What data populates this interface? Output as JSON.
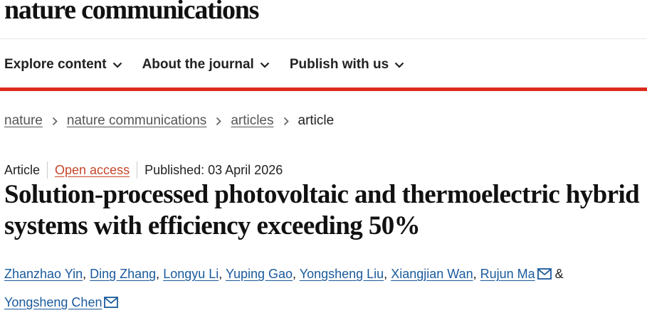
{
  "brand": {
    "name": "nature communications"
  },
  "nav": {
    "items": [
      {
        "label": "Explore content",
        "icon": "chevron-down-icon"
      },
      {
        "label": "About the journal",
        "icon": "chevron-down-icon"
      },
      {
        "label": "Publish with us",
        "icon": "chevron-down-icon"
      }
    ]
  },
  "colors": {
    "accent_rule": "#dd2b1e",
    "open_access": "#c6462a",
    "author_link": "#1a5a9c"
  },
  "breadcrumb": {
    "items": [
      {
        "label": "nature",
        "link": true
      },
      {
        "label": "nature communications",
        "link": true
      },
      {
        "label": "articles",
        "link": true
      },
      {
        "label": "article",
        "link": false
      }
    ],
    "separator_icon": "chevron-right-icon"
  },
  "meta": {
    "type": "Article",
    "access": "Open access",
    "published": "Published: 03 April 2026"
  },
  "article": {
    "title": "Solution-processed photovoltaic and thermoelectric hybrid systems with efficiency exceeding 50%"
  },
  "authors": {
    "list": [
      {
        "name": "Zhanzhao Yin",
        "sep": ", "
      },
      {
        "name": "Ding Zhang",
        "sep": ", "
      },
      {
        "name": "Longyu Li",
        "sep": ", "
      },
      {
        "name": "Yuping Gao",
        "sep": ", "
      },
      {
        "name": "Yongsheng Liu",
        "sep": ", "
      },
      {
        "name": "Xiangjian Wan",
        "sep": ", "
      },
      {
        "name": "Rujun Ma",
        "sep": ""
      },
      {
        "name": "Yongsheng Chen",
        "sep": ""
      }
    ],
    "conjunction": " & ",
    "mail_icon": "envelope-icon"
  }
}
